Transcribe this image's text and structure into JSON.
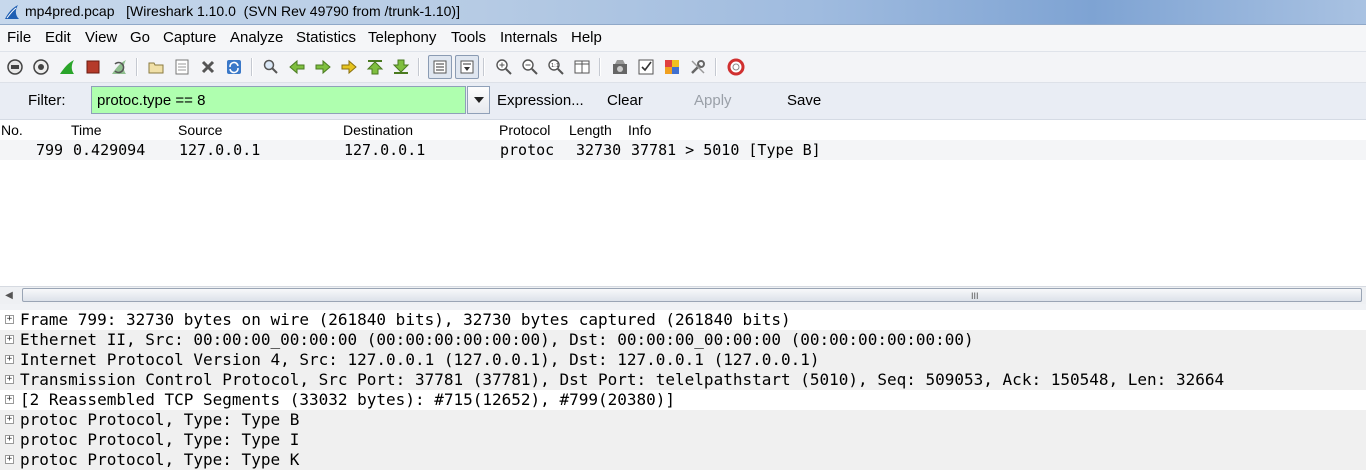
{
  "window": {
    "title": "mp4pred.pcap   [Wireshark 1.10.0  (SVN Rev 49790 from /trunk-1.10)]"
  },
  "menu": [
    "File",
    "Edit",
    "View",
    "Go",
    "Capture",
    "Analyze",
    "Statistics",
    "Telephony",
    "Tools",
    "Internals",
    "Help"
  ],
  "toolbar_icons": [
    "interfaces-icon",
    "options-icon",
    "start-capture-icon",
    "stop-capture-icon",
    "restart-capture-icon",
    "open-icon",
    "save-icon",
    "close-icon",
    "reload-icon",
    "find-icon",
    "back-icon",
    "forward-icon",
    "goto-icon",
    "first-packet-icon",
    "last-packet-icon",
    "colorize-icon",
    "autoscroll-icon",
    "zoom-in-icon",
    "zoom-out-icon",
    "normal-size-icon",
    "resize-columns-icon",
    "capture-filters-icon",
    "display-filters-icon",
    "coloring-rules-icon",
    "preferences-icon",
    "help-icon"
  ],
  "filter": {
    "label": "Filter:",
    "value": "protoc.type == 8",
    "expression": "Expression...",
    "clear": "Clear",
    "apply": "Apply",
    "save": "Save",
    "bg_color": "#afffaf"
  },
  "packet_list": {
    "columns": [
      "No.",
      "Time",
      "Source",
      "Destination",
      "Protocol",
      "Length",
      "Info"
    ],
    "rows": [
      {
        "no": "799",
        "time": "0.429094",
        "source": "127.0.0.1",
        "destination": "127.0.0.1",
        "protocol": "protoc",
        "length": "32730",
        "info": "37781 > 5010 [Type B]"
      }
    ]
  },
  "details": [
    "Frame 799: 32730 bytes on wire (261840 bits), 32730 bytes captured (261840 bits)",
    "Ethernet II, Src: 00:00:00_00:00:00 (00:00:00:00:00:00), Dst: 00:00:00_00:00:00 (00:00:00:00:00:00)",
    "Internet Protocol Version 4, Src: 127.0.0.1 (127.0.0.1), Dst: 127.0.0.1 (127.0.0.1)",
    "Transmission Control Protocol, Src Port: 37781 (37781), Dst Port: telelpathstart (5010), Seq: 509053, Ack: 150548, Len: 32664",
    "[2 Reassembled TCP Segments (33032 bytes): #715(12652), #799(20380)]",
    "protoc Protocol, Type: Type B",
    "protoc Protocol, Type: Type I",
    "protoc Protocol, Type: Type K"
  ],
  "expander_symbol": "+",
  "scroll_grip": "III"
}
